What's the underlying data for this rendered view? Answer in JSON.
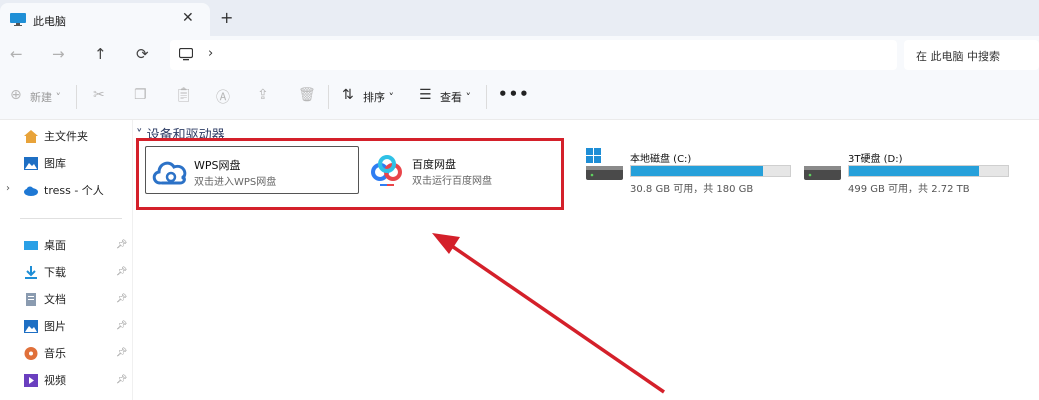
{
  "tab": {
    "title": "此电脑",
    "close": "✕",
    "new_tab": "+"
  },
  "nav": {
    "back": "←",
    "forward": "→",
    "up": "↑",
    "refresh": "⟳"
  },
  "address": {
    "chevron": "›"
  },
  "search": {
    "placeholder": "在 此电脑 中搜索"
  },
  "toolbar": {
    "new_label": "新建",
    "sort_label": "排序",
    "view_label": "查看",
    "more_label": "•••"
  },
  "sidebar": {
    "top_items": [
      {
        "label": "主文件夹",
        "icon": "home-icon"
      },
      {
        "label": "图库",
        "icon": "gallery-icon"
      },
      {
        "label": "tress - 个人",
        "icon": "cloud-icon"
      }
    ],
    "pinned_items": [
      {
        "label": "桌面",
        "icon": "desktop-icon"
      },
      {
        "label": "下载",
        "icon": "download-icon"
      },
      {
        "label": "文档",
        "icon": "document-icon"
      },
      {
        "label": "图片",
        "icon": "pictures-icon"
      },
      {
        "label": "音乐",
        "icon": "music-icon"
      },
      {
        "label": "视频",
        "icon": "video-icon"
      }
    ]
  },
  "content": {
    "group_title": "设备和驱动器",
    "cards": [
      {
        "title": "WPS网盘",
        "subtitle": "双击进入WPS网盘"
      },
      {
        "title": "百度网盘",
        "subtitle": "双击运行百度网盘"
      }
    ],
    "drives": [
      {
        "name": "本地磁盘 (C:)",
        "info": "30.8 GB 可用，共 180 GB",
        "used_fraction": 0.83
      },
      {
        "name": "3T硬盘 (D:)",
        "info": "499 GB 可用，共 2.72 TB",
        "used_fraction": 0.82
      }
    ]
  },
  "colors": {
    "accent": "#26a0da",
    "highlight": "#d4202a"
  }
}
